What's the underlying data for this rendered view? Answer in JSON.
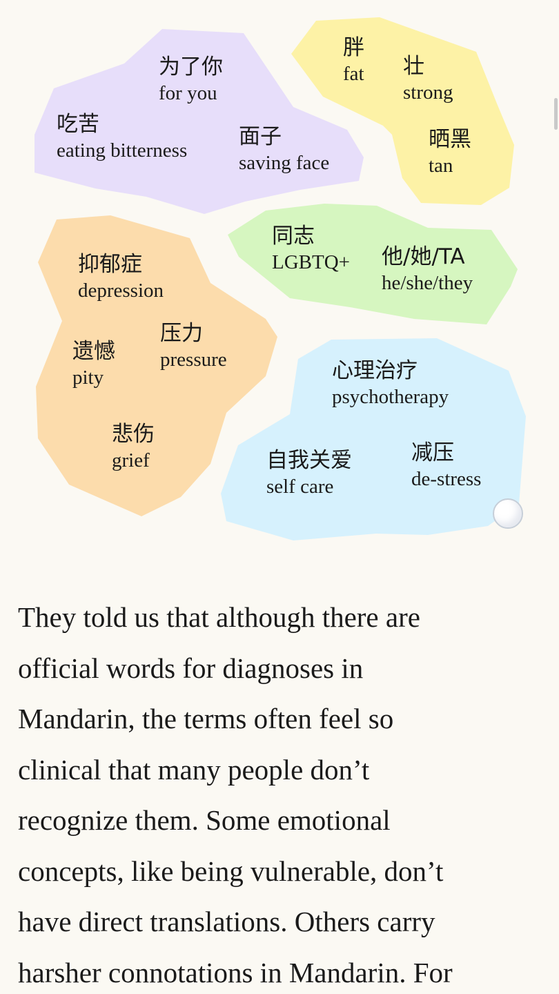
{
  "colors": {
    "background": "#fbf9f3",
    "purple": "#e7defa",
    "yellow": "#fdf2a6",
    "orange": "#fcdcac",
    "green": "#d6f6c0",
    "blue": "#d6f1fd",
    "text": "#1a1a1a"
  },
  "groups": {
    "family": {
      "terms": [
        {
          "zh": "为了你",
          "en": "for you"
        },
        {
          "zh": "吃苦",
          "en": "eating bitterness"
        },
        {
          "zh": "面子",
          "en": "saving face"
        }
      ]
    },
    "body": {
      "terms": [
        {
          "zh": "胖",
          "en": "fat"
        },
        {
          "zh": "壮",
          "en": "strong"
        },
        {
          "zh": "晒黑",
          "en": "tan"
        }
      ]
    },
    "emotions": {
      "terms": [
        {
          "zh": "抑郁症",
          "en": "depression"
        },
        {
          "zh": "压力",
          "en": "pressure"
        },
        {
          "zh": "遗憾",
          "en": "pity"
        },
        {
          "zh": "悲伤",
          "en": "grief"
        }
      ]
    },
    "identity": {
      "terms": [
        {
          "zh": "同志",
          "en": "LGBTQ+"
        },
        {
          "zh": "他/她/TA",
          "en": "he/she/they"
        }
      ]
    },
    "care": {
      "terms": [
        {
          "zh": "心理治疗",
          "en": "psychotherapy"
        },
        {
          "zh": "自我关爱",
          "en": "self care"
        },
        {
          "zh": "减压",
          "en": "de-stress"
        }
      ]
    }
  },
  "article": {
    "lines": [
      "They told us that although there are",
      "official words for diagnoses in",
      "Mandarin, the terms often feel so",
      "clinical that many people don’t",
      "recognize them. Some emotional",
      "concepts, like being vulnerable, don’t",
      "have direct translations. Others carry",
      "harsher connotations in Mandarin. For"
    ]
  }
}
